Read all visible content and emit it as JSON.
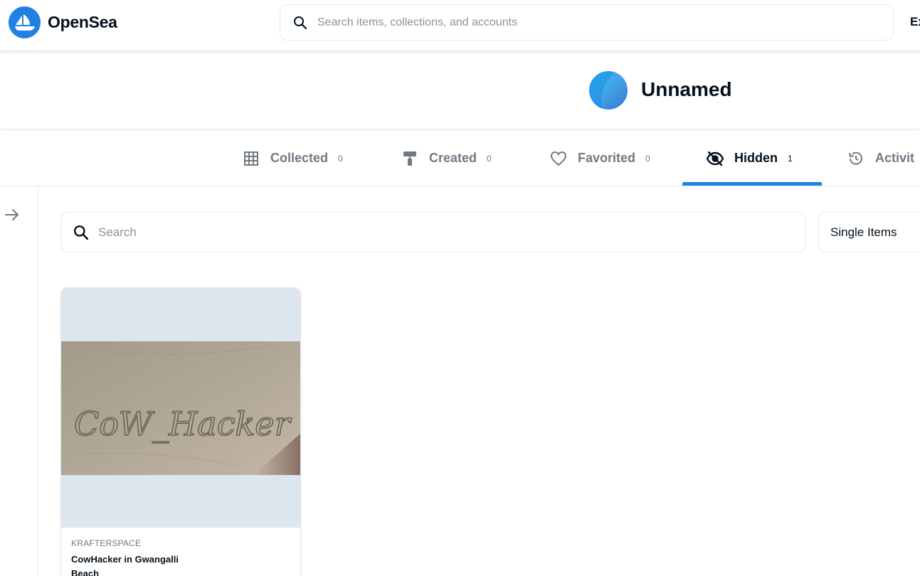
{
  "header": {
    "brand": "OpenSea",
    "search_placeholder": "Search items, collections, and accounts",
    "nav_partial": "Ex"
  },
  "profile": {
    "name": "Unnamed"
  },
  "tabs": [
    {
      "label": "Collected",
      "count": "0",
      "icon": "grid-icon"
    },
    {
      "label": "Created",
      "count": "0",
      "icon": "paint-roller-icon"
    },
    {
      "label": "Favorited",
      "count": "0",
      "icon": "heart-icon"
    },
    {
      "label": "Hidden",
      "count": "1",
      "icon": "eye-off-icon",
      "active": true
    },
    {
      "label": "Activit",
      "count": "",
      "icon": "history-icon"
    }
  ],
  "filters": {
    "search_placeholder": "Search",
    "item_type": "Single Items"
  },
  "items": [
    {
      "collection": "KRAFTERSPACE",
      "title": "CowHacker in Gwangalli Beach",
      "image_text": "CoW_Hacker"
    }
  ],
  "colors": {
    "brand": "#2081e2",
    "text_primary": "#04111d",
    "text_secondary": "#707a83",
    "border": "#e5e8eb",
    "media_bg": "#dde5ee"
  }
}
